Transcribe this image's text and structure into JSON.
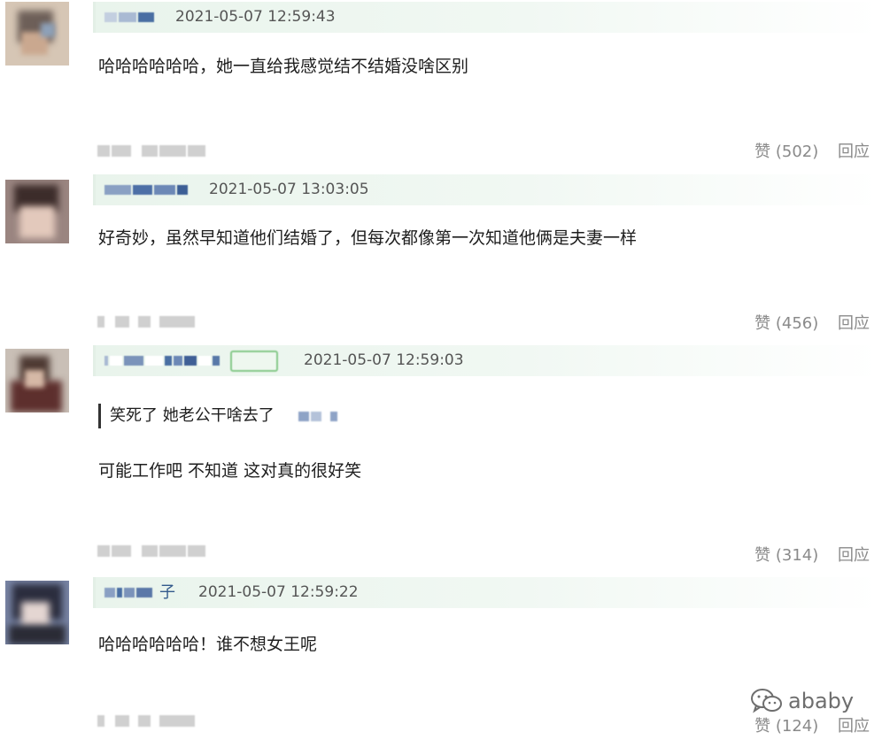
{
  "comments": [
    {
      "timestamp": "2021-05-07 12:59:43",
      "text": "哈哈哈哈哈哈，她一直给我感觉结不结婚没啥区别",
      "likes_label": "赞 (502)",
      "reply_label": "回应"
    },
    {
      "timestamp": "2021-05-07 13:03:05",
      "text": "好奇妙，虽然早知道他们结婚了，但每次都像第一次知道他俩是夫妻一样",
      "likes_label": "赞 (456)",
      "reply_label": "回应"
    },
    {
      "timestamp": "2021-05-07 12:59:03",
      "quote": "笑死了 她老公干啥去了",
      "text": "可能工作吧 不知道 这对真的很好笑",
      "likes_label": "赞 (314)",
      "reply_label": "回应"
    },
    {
      "username_suffix": "子",
      "timestamp": "2021-05-07 12:59:22",
      "text": "哈哈哈哈哈哈！谁不想女王呢",
      "likes_label": "赞 (124)",
      "reply_label": "回应"
    }
  ],
  "watermark": {
    "text": "ababy",
    "icon": "wechat-icon"
  },
  "colors": {
    "header_bg": "#e9f4ec",
    "meta_text": "#8a8a8a",
    "username_link": "#335a8c"
  }
}
